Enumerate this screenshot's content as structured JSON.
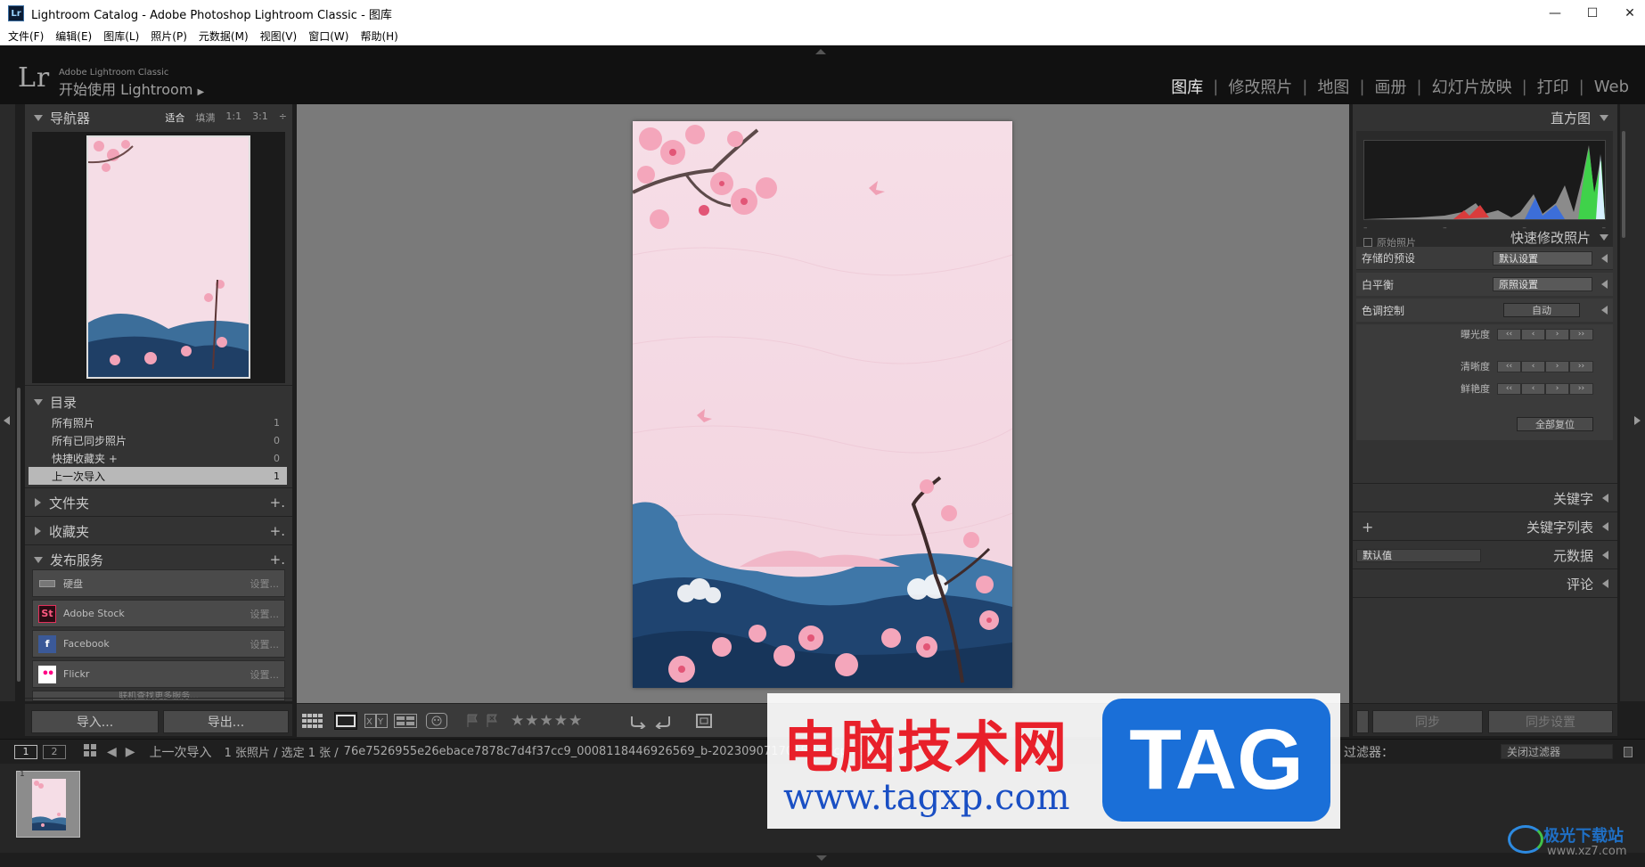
{
  "window": {
    "title": "Lightroom Catalog - Adobe Photoshop Lightroom Classic - 图库",
    "app_icon_text": "Lr",
    "controls": {
      "minimize": "—",
      "maximize": "☐",
      "close": "✕"
    }
  },
  "menu": [
    "文件(F)",
    "编辑(E)",
    "图库(L)",
    "照片(P)",
    "元数据(M)",
    "视图(V)",
    "窗口(W)",
    "帮助(H)"
  ],
  "identity": {
    "logo": "Lr",
    "brand_small": "Adobe Lightroom Classic",
    "brand_large": "开始使用 Lightroom",
    "brand_arrow": "▶"
  },
  "modules": [
    {
      "label": "图库",
      "active": true
    },
    {
      "label": "修改照片",
      "active": false
    },
    {
      "label": "地图",
      "active": false
    },
    {
      "label": "画册",
      "active": false
    },
    {
      "label": "幻灯片放映",
      "active": false
    },
    {
      "label": "打印",
      "active": false
    },
    {
      "label": "Web",
      "active": false
    }
  ],
  "navigator": {
    "title": "导航器",
    "zoom": [
      "适合",
      "填满",
      "1:1",
      "3:1"
    ],
    "zoom_more": "÷"
  },
  "catalog": {
    "title": "目录",
    "items": [
      {
        "label": "所有照片",
        "count": "1",
        "selected": false
      },
      {
        "label": "所有已同步照片",
        "count": "0",
        "selected": false
      },
      {
        "label": "快捷收藏夹 +",
        "count": "0",
        "selected": false
      },
      {
        "label": "上一次导入",
        "count": "1",
        "selected": true
      }
    ]
  },
  "folders": {
    "title": "文件夹",
    "add": "+."
  },
  "collections": {
    "title": "收藏夹",
    "add": "+."
  },
  "publish": {
    "title": "发布服务",
    "add": "+.",
    "services": [
      {
        "label": "硬盘",
        "settings": "设置...",
        "icon": "hard-drive-icon",
        "badge": ""
      },
      {
        "label": "Adobe Stock",
        "settings": "设置...",
        "icon": "adobe-stock-icon",
        "badge": "St"
      },
      {
        "label": "Facebook",
        "settings": "设置...",
        "icon": "facebook-icon",
        "badge": "f"
      },
      {
        "label": "Flickr",
        "settings": "设置...",
        "icon": "flickr-icon",
        "badge": "••"
      }
    ],
    "more": "联机查找更多服务..."
  },
  "left_buttons": {
    "import": "导入...",
    "export": "导出..."
  },
  "histogram": {
    "title": "直方图",
    "original_photo": "原始照片"
  },
  "quick_develop": {
    "title": "快速修改照片",
    "saved_preset_label": "存储的预设",
    "saved_preset_value": "默认设置",
    "white_balance_label": "白平衡",
    "white_balance_value": "原照设置",
    "tone_control_label": "色调控制",
    "auto_label": "自动",
    "sliders": [
      {
        "label": "曝光度"
      },
      {
        "label": "清晰度"
      },
      {
        "label": "鲜艳度"
      }
    ],
    "reset_all": "全部复位",
    "seg_labels": [
      "‹‹",
      "‹",
      "›",
      "››"
    ]
  },
  "keywords": {
    "title": "关键字"
  },
  "keyword_list": {
    "title": "关键字列表",
    "add": "+"
  },
  "metadata": {
    "title": "元数据",
    "preset": "默认值"
  },
  "comments": {
    "title": "评论"
  },
  "sync": {
    "sync_label": "同步",
    "sync_settings_label": "同步设置"
  },
  "toolbar": {
    "stars": "★★★★★"
  },
  "filmstrip": {
    "screen1": "1",
    "screen2": "2",
    "source": "上一次导入",
    "count_info": "1 张照片 / 选定 1 张 /",
    "filename": "76e7526955e26ebace7878c7d4f37cc9_0008118446926569_b-20230907170150-x6cpm94.jpg",
    "filter_label": "过滤器：",
    "filter_value": "关闭过滤器",
    "thumb_index": "1"
  },
  "watermark": {
    "cn_text": "电脑技术网",
    "url": "www.tagxp.com",
    "tag": "TAG",
    "corner_brand": "极光下载站",
    "corner_url": "www.xz7.com"
  },
  "colors": {
    "panel": "#333333",
    "center": "#7a7a7a",
    "accent_red": "#e8202a",
    "accent_blue": "#1a6fd8"
  }
}
